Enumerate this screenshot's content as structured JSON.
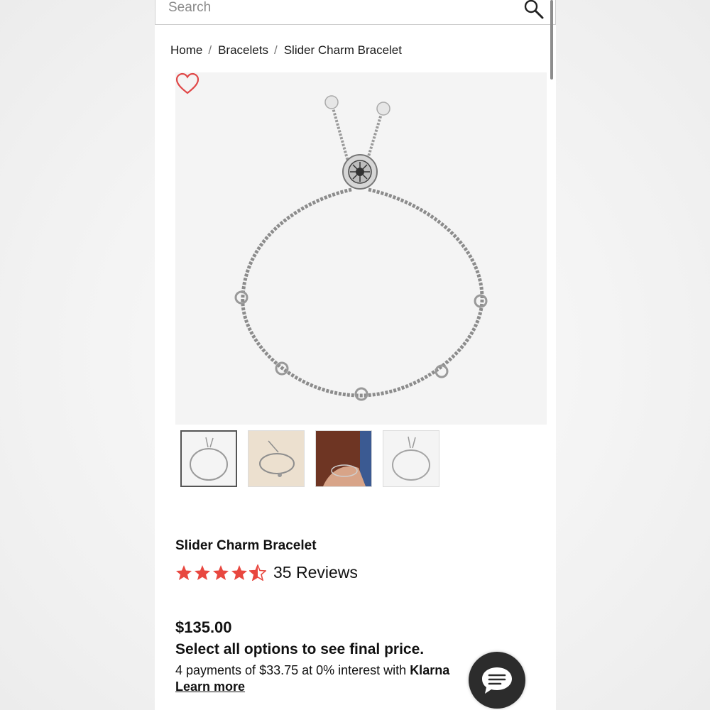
{
  "search": {
    "placeholder": "Search",
    "icon": "search-icon"
  },
  "breadcrumb": {
    "items": [
      "Home",
      "Bracelets",
      "Slider Charm Bracelet"
    ],
    "separator": "/"
  },
  "gallery": {
    "main_image": "bracelet-image",
    "favorite_icon": "heart-icon",
    "thumbnails": [
      "thumbnail-bracelet-front",
      "thumbnail-bracelet-lifestyle",
      "thumbnail-bracelet-on-wrist",
      "thumbnail-bracelet-alt"
    ]
  },
  "product": {
    "title": "Slider Charm Bracelet",
    "rating": 4.5,
    "reviews_label": "35 Reviews",
    "price": "$135.00",
    "options_note": "Select all options to see final price.",
    "installment_text": "4 payments of $33.75 at 0% interest with ",
    "installment_brand": "Klarna",
    "learn_more": "Learn more"
  },
  "colors": {
    "star": "#e8473f",
    "heart": "#e04848",
    "chat": "#2c2c2c"
  },
  "chat": {
    "icon": "chat-bubble-icon"
  }
}
